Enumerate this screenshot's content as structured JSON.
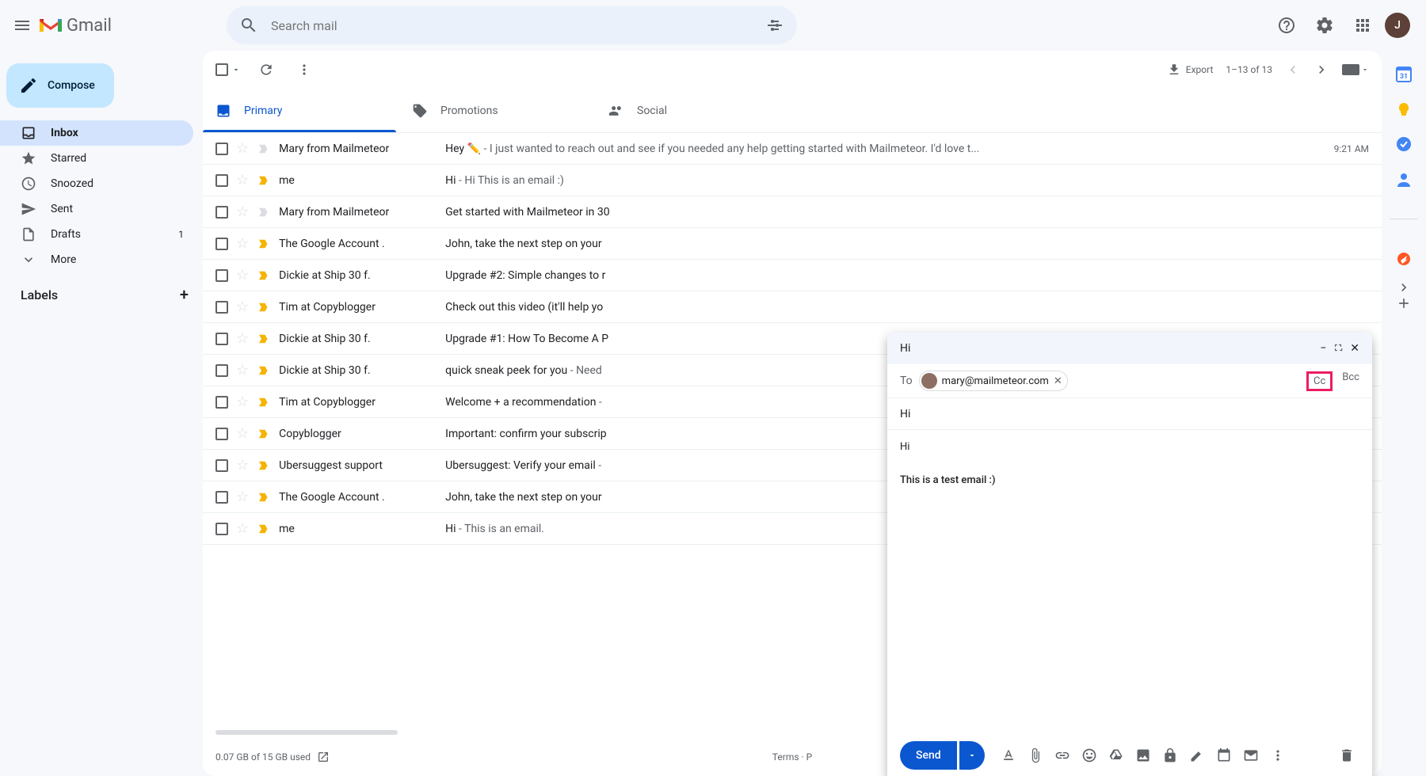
{
  "header": {
    "app_name": "Gmail",
    "search_placeholder": "Search mail",
    "avatar_initial": "J"
  },
  "sidebar": {
    "compose_label": "Compose",
    "items": [
      {
        "label": "Inbox",
        "icon": "inbox",
        "active": true
      },
      {
        "label": "Starred",
        "icon": "star"
      },
      {
        "label": "Snoozed",
        "icon": "clock"
      },
      {
        "label": "Sent",
        "icon": "send"
      },
      {
        "label": "Drafts",
        "icon": "draft",
        "count": "1"
      },
      {
        "label": "More",
        "icon": "expand"
      }
    ],
    "labels_header": "Labels"
  },
  "toolbar": {
    "export_label": "Export",
    "range": "1–13 of 13"
  },
  "tabs": [
    {
      "label": "Primary",
      "active": true
    },
    {
      "label": "Promotions"
    },
    {
      "label": "Social"
    }
  ],
  "emails": [
    {
      "sender": "Mary from Mailmeteor",
      "subject": "Hey ✏️",
      "snippet": " -  I just wanted to reach out and see if you needed any help getting started with Mailmeteor. I'd love t...",
      "time": "9:21 AM",
      "important": "gray"
    },
    {
      "sender": "me",
      "subject": "Hi",
      "snippet": " - Hi This is an email :)",
      "important": "yellow"
    },
    {
      "sender": "Mary from Mailmeteor",
      "subject": "Get started with Mailmeteor in 30",
      "snippet": "",
      "important": "gray"
    },
    {
      "sender": "The Google Account .",
      "subject": "John, take the next step on your",
      "snippet": "",
      "important": "yellow"
    },
    {
      "sender": "Dickie at Ship 30 f.",
      "subject": "Upgrade #2: Simple changes to r",
      "snippet": "",
      "important": "yellow"
    },
    {
      "sender": "Tim at Copyblogger",
      "subject": "Check out this video (it'll help yo",
      "snippet": "",
      "important": "yellow"
    },
    {
      "sender": "Dickie at Ship 30 f.",
      "subject": "Upgrade #1: How To Become A P",
      "snippet": "",
      "important": "yellow"
    },
    {
      "sender": "Dickie at Ship 30 f.",
      "subject": "quick sneak peek for you",
      "snippet": " - Need",
      "important": "yellow"
    },
    {
      "sender": "Tim at Copyblogger",
      "subject": "Welcome + a recommendation",
      "snippet": " - ",
      "important": "yellow"
    },
    {
      "sender": "Copyblogger",
      "subject": "Important: confirm your subscrip",
      "snippet": "",
      "important": "yellow"
    },
    {
      "sender": "Ubersuggest support",
      "subject": "Ubersuggest: Verify your email",
      "snippet": " - ",
      "important": "yellow"
    },
    {
      "sender": "The Google Account .",
      "subject": "John, take the next step on your",
      "snippet": "",
      "important": "yellow"
    },
    {
      "sender": "me",
      "subject": "Hi",
      "snippet": " - This is an email.",
      "important": "yellow"
    }
  ],
  "footer": {
    "storage": "0.07 GB of 15 GB used",
    "terms": "Terms · P"
  },
  "compose": {
    "title": "Hi",
    "to_label": "To",
    "recipient": "mary@mailmeteor.com",
    "cc": "Cc",
    "bcc": "Bcc",
    "subject": "Hi",
    "body_line1": "Hi",
    "body_line2": "This is a test email :)",
    "send_label": "Send"
  }
}
